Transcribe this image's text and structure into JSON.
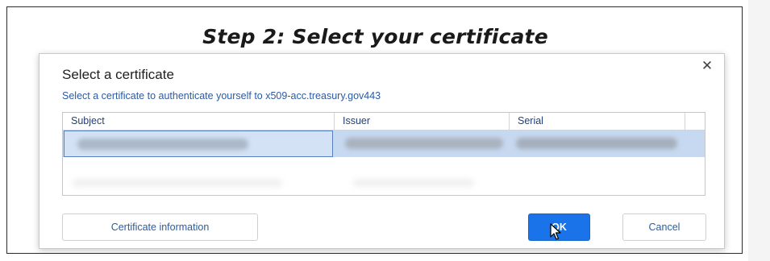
{
  "heading": {
    "step_title": "Step 2: Select your certificate"
  },
  "dialog": {
    "title": "Select a certificate",
    "subtitle": "Select a certificate to authenticate yourself to x509-acc.treasury.gov443",
    "close_icon": "close-icon",
    "close_glyph": "✕",
    "table": {
      "columns": [
        "Subject",
        "Issuer",
        "Serial"
      ],
      "selected_row": {
        "subject": "",
        "issuer": "",
        "serial": ""
      }
    },
    "buttons": {
      "certificate_info": "Certificate information",
      "ok": "OK",
      "cancel": "Cancel"
    }
  },
  "colors": {
    "ok_button": "#1a73e8",
    "selected_row": "#c7d9f0",
    "link_text": "#2a5c9e"
  },
  "icons": {
    "pointer": "mouse-pointer-icon"
  }
}
